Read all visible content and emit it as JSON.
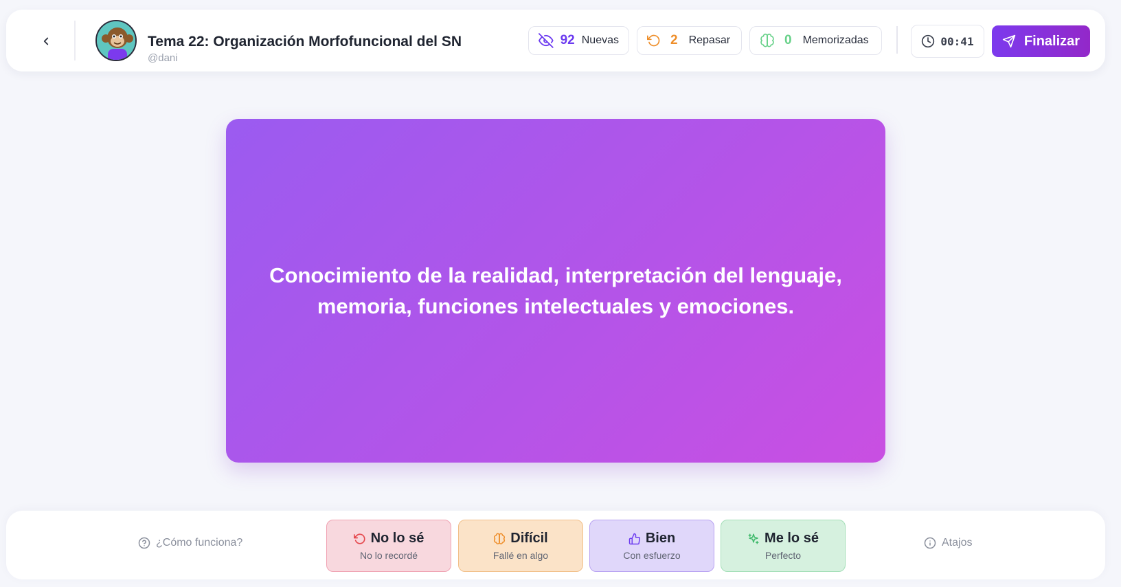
{
  "header": {
    "back_icon": "chevron-left-icon",
    "avatar": "monkey-avatar",
    "title": "Tema 22: Organización Morfofuncional del SN",
    "user": "@dani",
    "stats": {
      "new_count": "92",
      "new_label": "Nuevas",
      "review_count": "2",
      "review_label": "Repasar",
      "memorized_count": "0",
      "memorized_label": "Memorizadas"
    },
    "timer": "00:41",
    "finish_label": "Finalizar"
  },
  "card": {
    "text": "Conocimiento de la realidad, interpretación del lenguaje, memoria, funciones intelectuales y emociones."
  },
  "footer": {
    "help_label": "¿Cómo funciona?",
    "shortcuts_label": "Atajos",
    "buttons": [
      {
        "label": "No lo sé",
        "sub": "No lo recordé",
        "icon": "undo-icon",
        "color": "#e5484d"
      },
      {
        "label": "Difícil",
        "sub": "Fallé en algo",
        "icon": "brain-icon",
        "color": "#ee8e2a"
      },
      {
        "label": "Bien",
        "sub": "Con esfuerzo",
        "icon": "thumbs-up-icon",
        "color": "#6c3bf0"
      },
      {
        "label": "Me lo sé",
        "sub": "Perfecto",
        "icon": "sparkles-icon",
        "color": "#3fb96b"
      }
    ]
  },
  "colors": {
    "accent": "#7c3aed",
    "card_gradient_start": "#9b5bf0",
    "card_gradient_end": "#c94fe2",
    "background": "#f5f6fb"
  }
}
